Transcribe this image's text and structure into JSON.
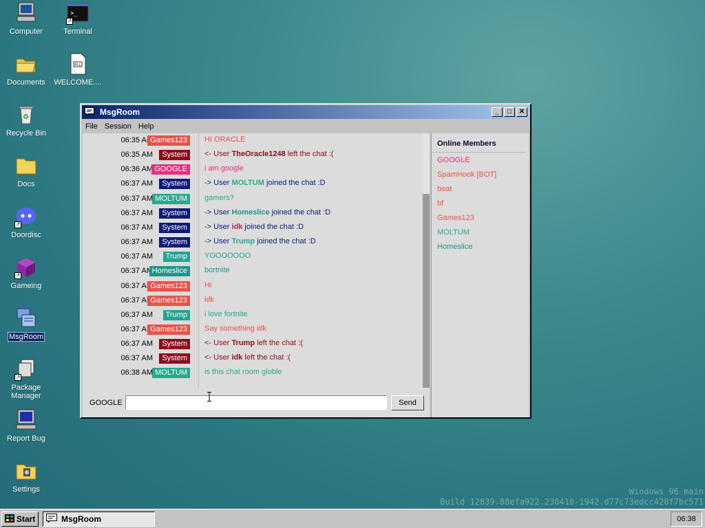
{
  "desktop": {
    "icons": [
      {
        "label": "Computer",
        "icon": "computer-icon"
      },
      {
        "label": "Terminal",
        "icon": "terminal-icon"
      },
      {
        "label": "Documents",
        "icon": "folder-open-icon"
      },
      {
        "label": "WELCOME....",
        "icon": "markdown-file-icon"
      },
      {
        "label": "Recycle Bin",
        "icon": "recycle-bin-icon"
      },
      {
        "label": "Docs",
        "icon": "folder-icon"
      },
      {
        "label": "Doordisc",
        "icon": "doordisc-icon"
      },
      {
        "label": "Gameing",
        "icon": "cube-icon"
      },
      {
        "label": "MsgRoom",
        "icon": "msgroom-icon"
      },
      {
        "label": "Package Manager",
        "icon": "package-manager-icon"
      },
      {
        "label": "Report Bug",
        "icon": "report-bug-icon"
      },
      {
        "label": "Settings",
        "icon": "settings-icon"
      }
    ],
    "watermark": {
      "line1": "Windows 96 main",
      "line2": "Build 12839.88efa922.230410-1942.d77c73edcc428f7bc571"
    }
  },
  "window": {
    "title": "MsgRoom",
    "buttons": {
      "minimize": "_",
      "maximize": "□",
      "close": "✕"
    },
    "menu": [
      "File",
      "Session",
      "Help"
    ],
    "colors": {
      "Games123": "#e8524a",
      "System": "#8b0b1a",
      "GOOGLE": "#e7307b",
      "MOLTUM": "#27a98c",
      "Homeslice": "#21948a",
      "Trump": "#24a393"
    },
    "messages": [
      {
        "time": "06:35 AM",
        "user": "Games123",
        "user_color": "#e8524a",
        "pre": "HI ORACLE",
        "bold": "",
        "post": "",
        "text_color": "#e8524a"
      },
      {
        "time": "06:35 AM",
        "user": "System",
        "user_color": "#8b0b1a",
        "pre": "<- User ",
        "bold": "TheOracle1248",
        "post": " left the chat :(",
        "text_color": "#8b0b1a"
      },
      {
        "time": "06:36 AM",
        "user": "GOOGLE",
        "user_color": "#e7307b",
        "pre": "i am google",
        "bold": "",
        "post": "",
        "text_color": "#e7307b"
      },
      {
        "time": "06:37 AM",
        "user": "System",
        "user_color": "#0b1a78",
        "pre": "-> User ",
        "bold": "MOLTUM",
        "post": " joined the chat :D",
        "text_color": "#0b1a78",
        "bold_color": "#27a98c"
      },
      {
        "time": "06:37 AM",
        "user": "MOLTUM",
        "user_color": "#27a98c",
        "pre": "gamers?",
        "bold": "",
        "post": "",
        "text_color": "#27a98c"
      },
      {
        "time": "06:37 AM",
        "user": "System",
        "user_color": "#0b1a78",
        "pre": "-> User ",
        "bold": "Homeslice",
        "post": " joined the chat :D",
        "text_color": "#0b1a78",
        "bold_color": "#21948a"
      },
      {
        "time": "06:37 AM",
        "user": "System",
        "user_color": "#0b1a78",
        "pre": "-> User ",
        "bold": "idk",
        "post": " joined the chat :D",
        "text_color": "#0b1a78",
        "bold_color": "#b5245a"
      },
      {
        "time": "06:37 AM",
        "user": "System",
        "user_color": "#0b1a78",
        "pre": "-> User ",
        "bold": "Trump",
        "post": " joined the chat :D",
        "text_color": "#0b1a78",
        "bold_color": "#24a393"
      },
      {
        "time": "06:37 AM",
        "user": "Trump",
        "user_color": "#24a393",
        "pre": "YOOOOOOO",
        "bold": "",
        "post": "",
        "text_color": "#24a393"
      },
      {
        "time": "06:37 AM",
        "user": "Homeslice",
        "user_color": "#21948a",
        "pre": "bortnite",
        "bold": "",
        "post": "",
        "text_color": "#21948a"
      },
      {
        "time": "06:37 AM",
        "user": "Games123",
        "user_color": "#e8524a",
        "pre": "Hi",
        "bold": "",
        "post": "",
        "text_color": "#e8524a"
      },
      {
        "time": "06:37 AM",
        "user": "Games123",
        "user_color": "#e8524a",
        "pre": "idk",
        "bold": "",
        "post": "",
        "text_color": "#e8524a"
      },
      {
        "time": "06:37 AM",
        "user": "Trump",
        "user_color": "#24a393",
        "pre": "i love fortnite",
        "bold": "",
        "post": "",
        "text_color": "#24a393"
      },
      {
        "time": "06:37 AM",
        "user": "Games123",
        "user_color": "#e8524a",
        "pre": "Say something idk",
        "bold": "",
        "post": "",
        "text_color": "#e8524a"
      },
      {
        "time": "06:37 AM",
        "user": "System",
        "user_color": "#8b0b1a",
        "pre": "<- User ",
        "bold": "Trump",
        "post": " left the chat :(",
        "text_color": "#8b0b1a"
      },
      {
        "time": "06:37 AM",
        "user": "System",
        "user_color": "#8b0b1a",
        "pre": "<- User ",
        "bold": "idk",
        "post": " left the chat :(",
        "text_color": "#8b0b1a"
      },
      {
        "time": "06:38 AM",
        "user": "MOLTUM",
        "user_color": "#27a98c",
        "pre": "is this chat room globle",
        "bold": "",
        "post": "",
        "text_color": "#27a98c"
      }
    ],
    "members_title": "Online Members",
    "members": [
      {
        "name": "GOOGLE",
        "color": "#e7307b"
      },
      {
        "name": "SpamHook [BOT]",
        "color": "#e8524a"
      },
      {
        "name": "boat",
        "color": "#e8524a"
      },
      {
        "name": "bf",
        "color": "#e8524a"
      },
      {
        "name": "Games123",
        "color": "#e8524a"
      },
      {
        "name": "MOLTUM",
        "color": "#27a98c"
      },
      {
        "name": "Homeslice",
        "color": "#21948a"
      }
    ],
    "input": {
      "nick": "GOOGLE",
      "value": "",
      "send_label": "Send"
    }
  },
  "taskbar": {
    "start_label": "Start",
    "task_label": "MsgRoom",
    "clock": "06:38"
  }
}
